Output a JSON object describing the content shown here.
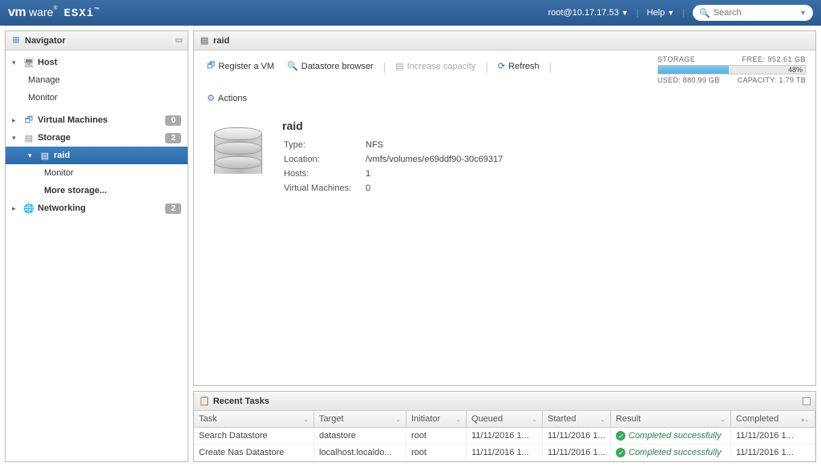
{
  "topbar": {
    "user": "root@10.17.17.53",
    "help": "Help",
    "search_placeholder": "Search"
  },
  "navigator": {
    "title": "Navigator",
    "host": "Host",
    "manage": "Manage",
    "monitor": "Monitor",
    "vms": {
      "label": "Virtual Machines",
      "count": "0"
    },
    "storage": {
      "label": "Storage",
      "count": "2"
    },
    "raid": "raid",
    "raid_monitor": "Monitor",
    "more_storage": "More storage...",
    "networking": {
      "label": "Networking",
      "count": "2"
    }
  },
  "content": {
    "title": "raid",
    "toolbar": {
      "register": "Register a VM",
      "browser": "Datastore browser",
      "increase": "Increase capacity",
      "refresh": "Refresh",
      "actions": "Actions"
    },
    "storage_meter": {
      "label": "STORAGE",
      "free": "FREE: 952.61 GB",
      "percent": "48%",
      "used": "USED: 880.99 GB",
      "capacity": "CAPACITY: 1.79 TB",
      "percent_value": 48
    },
    "datastore": {
      "name": "raid",
      "labels": {
        "type": "Type:",
        "location": "Location:",
        "hosts": "Hosts:",
        "vms": "Virtual Machines:"
      },
      "type": "NFS",
      "location": "/vmfs/volumes/e69ddf90-30c69317",
      "hosts": "1",
      "vms": "0"
    }
  },
  "tasks": {
    "title": "Recent Tasks",
    "headers": {
      "task": "Task",
      "target": "Target",
      "initiator": "Initiator",
      "queued": "Queued",
      "started": "Started",
      "result": "Result",
      "completed": "Completed"
    },
    "rows": [
      {
        "task": "Search Datastore",
        "target": "datastore",
        "initiator": "root",
        "queued": "11/11/2016 1...",
        "started": "11/11/2016 1...",
        "result": "Completed successfully",
        "completed": "11/11/2016 1..."
      },
      {
        "task": "Create Nas Datastore",
        "target": "localhost.localdo...",
        "initiator": "root",
        "queued": "11/11/2016 1...",
        "started": "11/11/2016 1...",
        "result": "Completed successfully",
        "completed": "11/11/2016 1..."
      }
    ]
  }
}
